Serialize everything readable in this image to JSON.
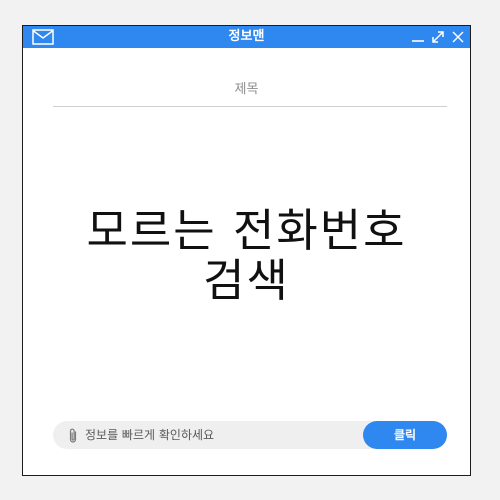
{
  "window": {
    "title": "정보맨"
  },
  "compose": {
    "subject_label": "제목",
    "headline_line1": "모르는 전화번호",
    "headline_line2": "검색"
  },
  "search": {
    "placeholder": "정보를 빠르게 확인하세요",
    "button_label": "클릭"
  },
  "icons": {
    "left": "mail-icon",
    "controls": [
      "minimize-icon",
      "resize-icon",
      "close-icon"
    ],
    "attachment": "paperclip-icon"
  },
  "colors": {
    "accent": "#2f87f0",
    "window_bg": "#ffffff",
    "page_bg": "#f2f2f2",
    "input_bg": "#efefef"
  }
}
